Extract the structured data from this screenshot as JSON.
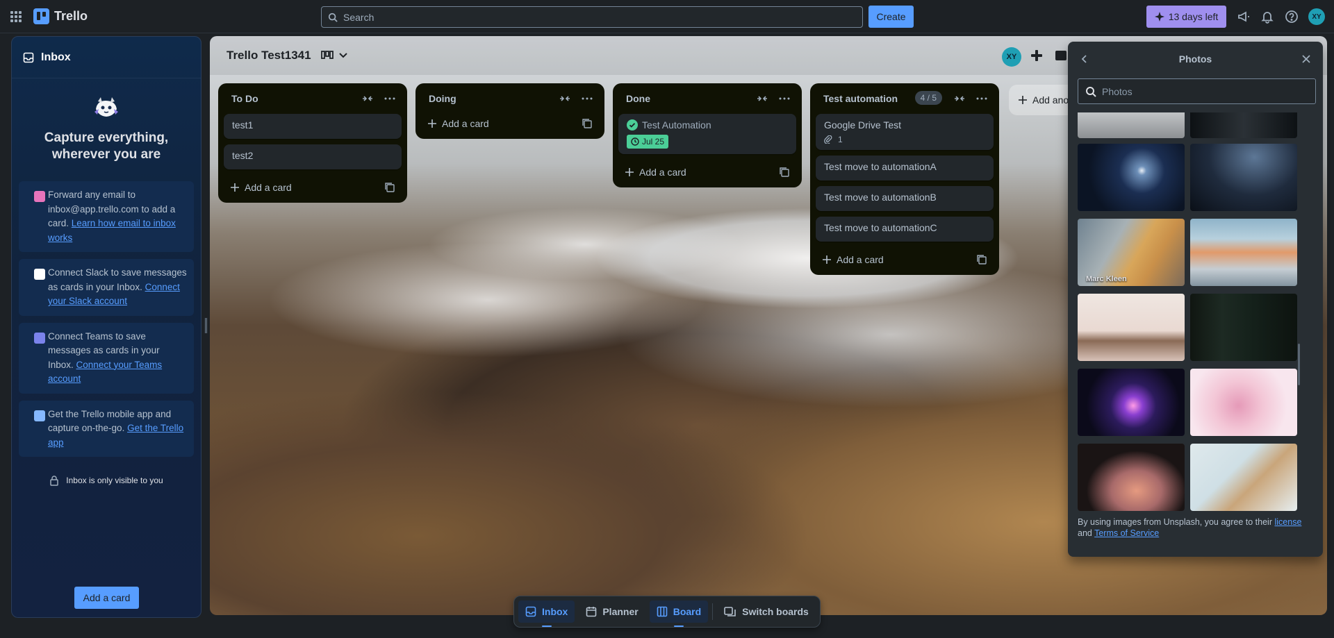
{
  "topbar": {
    "app_name": "Trello",
    "search_placeholder": "Search",
    "create_label": "Create",
    "trial_label": "13 days left",
    "avatar_initials": "XY"
  },
  "inbox": {
    "title": "Inbox",
    "headline": "Capture everything, wherever you are",
    "tips": [
      {
        "text": "Forward any email to inbox@app.trello.com to add a card.",
        "link": "Learn how email to inbox works",
        "icon": "email-icon"
      },
      {
        "text": "Connect Slack to save messages as cards in your Inbox.",
        "link": "Connect your Slack account",
        "icon": "slack-icon"
      },
      {
        "text": "Connect Teams to save messages as cards in your Inbox.",
        "link": "Connect your Teams account",
        "icon": "teams-icon"
      },
      {
        "text": "Get the Trello mobile app and capture on-the-go.",
        "link": "Get the Trello app",
        "icon": "mobile-icon"
      }
    ],
    "privacy": "Inbox is only visible to you",
    "add_card": "Add a card"
  },
  "board": {
    "title": "Trello Test1341",
    "avatar_initials": "XY",
    "add_another": "Add another list",
    "lists": [
      {
        "title": "To Do",
        "cards": [
          "test1",
          "test2"
        ],
        "add_label": "Add a card"
      },
      {
        "title": "Doing",
        "cards": [],
        "add_label": "Add a card"
      },
      {
        "title": "Done",
        "done_card": {
          "title": "Test Automation",
          "date": "Jul 25"
        },
        "add_label": "Add a card"
      },
      {
        "title": "Test automation",
        "count": "4 / 5",
        "first_card": {
          "title": "Google Drive Test",
          "attachments": "1"
        },
        "cards": [
          "Test move to automationA",
          "Test move to automationB",
          "Test move to automationC"
        ],
        "add_label": "Add a card"
      }
    ]
  },
  "photos": {
    "title": "Photos",
    "search_placeholder": "Photos",
    "caption": "Marc Kleen",
    "footer_text": "By using images from Unsplash, you agree to their",
    "license_link": "license",
    "and": "and",
    "tos_link": "Terms of Service"
  },
  "bottom_nav": {
    "inbox": "Inbox",
    "planner": "Planner",
    "board": "Board",
    "switch": "Switch boards"
  },
  "colors": {
    "accent": "#579dff",
    "trial": "#9f8fef",
    "date_badge": "#4bce97",
    "list_bg": "#101204"
  }
}
